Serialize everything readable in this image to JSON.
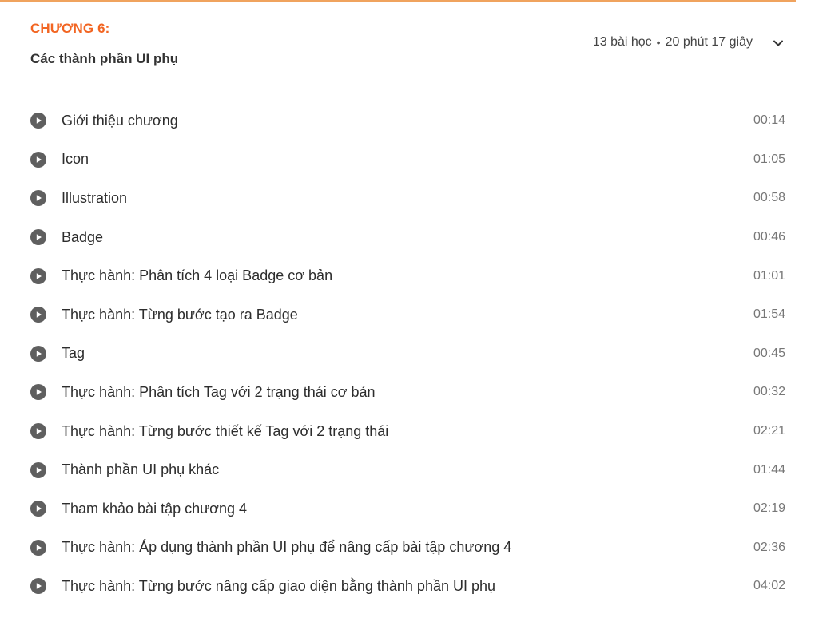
{
  "chapter": {
    "label": "CHƯƠNG 6:",
    "title": "Các thành phần UI phụ",
    "lesson_count": "13 bài học",
    "separator": "•",
    "total_duration": "20 phút 17 giây",
    "toggle_icon": "chevron-down-icon"
  },
  "colors": {
    "accent": "#f26522",
    "top_line": "#f0a35e",
    "play_icon": "#5f5f5f"
  },
  "lessons": [
    {
      "title": "Giới thiệu chương",
      "duration": "00:14"
    },
    {
      "title": "Icon",
      "duration": "01:05"
    },
    {
      "title": "Illustration",
      "duration": "00:58"
    },
    {
      "title": "Badge",
      "duration": "00:46"
    },
    {
      "title": "Thực hành: Phân tích 4 loại Badge cơ bản",
      "duration": "01:01"
    },
    {
      "title": "Thực hành: Từng bước tạo ra Badge",
      "duration": "01:54"
    },
    {
      "title": "Tag",
      "duration": "00:45"
    },
    {
      "title": "Thực hành: Phân tích Tag với 2 trạng thái cơ bản",
      "duration": "00:32"
    },
    {
      "title": "Thực hành: Từng bước thiết kế Tag với 2 trạng thái",
      "duration": "02:21"
    },
    {
      "title": "Thành phần UI phụ khác",
      "duration": "01:44"
    },
    {
      "title": "Tham khảo bài tập chương 4",
      "duration": "02:19"
    },
    {
      "title": "Thực hành: Áp dụng thành phần UI phụ để nâng cấp bài tập chương 4",
      "duration": "02:36"
    },
    {
      "title": "Thực hành: Từng bước nâng cấp giao diện bằng thành phần UI phụ",
      "duration": "04:02"
    }
  ]
}
